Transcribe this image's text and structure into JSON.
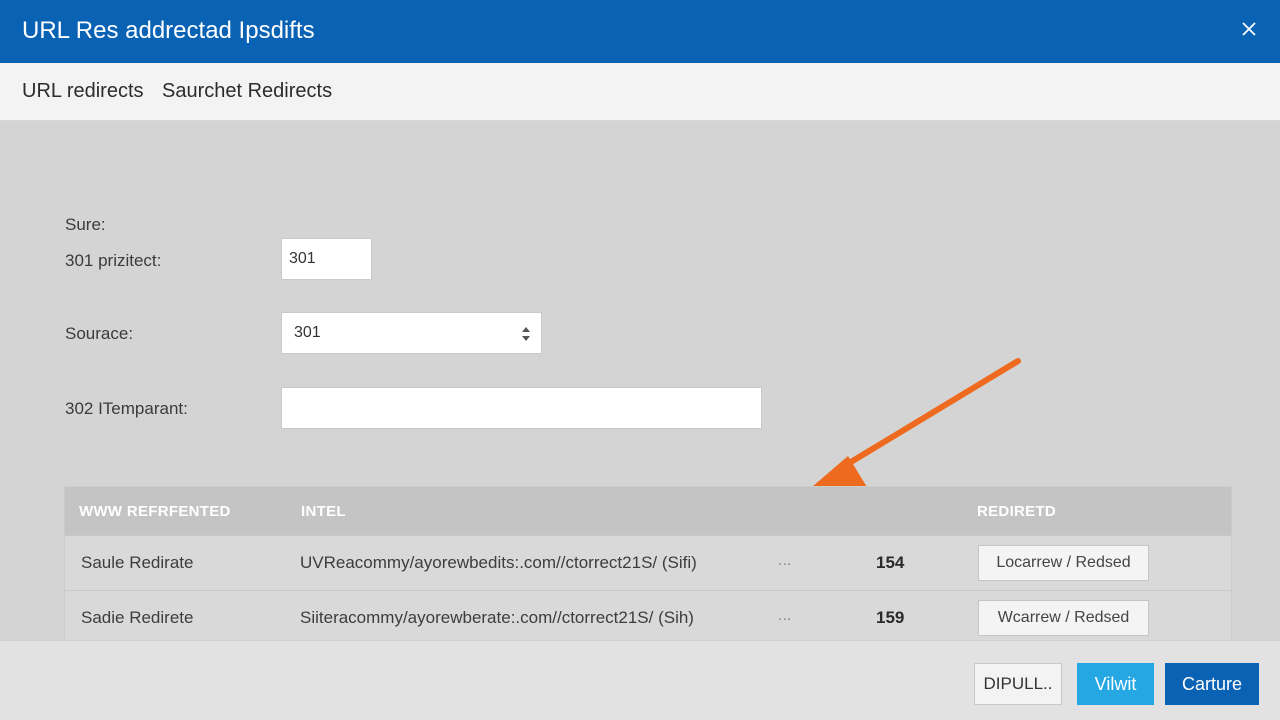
{
  "window": {
    "title": "URL Res addrectad Ipsdifts"
  },
  "subnav": {
    "items": [
      "URL redirects",
      "Saurchet Redirects"
    ]
  },
  "form": {
    "section_label": "Sure:",
    "permanent": {
      "label": "301 prizitect:",
      "value": "301"
    },
    "source": {
      "label": "Sourace:",
      "value": "301"
    },
    "temporary": {
      "label": "302 ITemparant:",
      "value": ""
    }
  },
  "table": {
    "headers": {
      "name": "WWW REFRFENTED",
      "intel": "INTEL",
      "redirect": "REDIRETD"
    },
    "rows": [
      {
        "name": "Saule Redirate",
        "url": "UVReacommy/ayorewbedits:.com//ctorrect21S/ (Sifi)",
        "dots": "...",
        "count": "154",
        "action": "Locarrew / Redsed"
      },
      {
        "name": "Sadie Redirete",
        "url": "Siiteracommy/ayorewberate:.com//ctorrect21S/ (Sih)",
        "dots": "...",
        "count": "159",
        "action": "Wcarrew / Redsed"
      }
    ]
  },
  "footer": {
    "default_label": "DIPULL..",
    "visit_label": "Vilwit",
    "capture_label": "Carture"
  },
  "colors": {
    "titlebar": "#0a62b5",
    "accent_light": "#25a7e3",
    "arrow": "#ee6a1f"
  }
}
